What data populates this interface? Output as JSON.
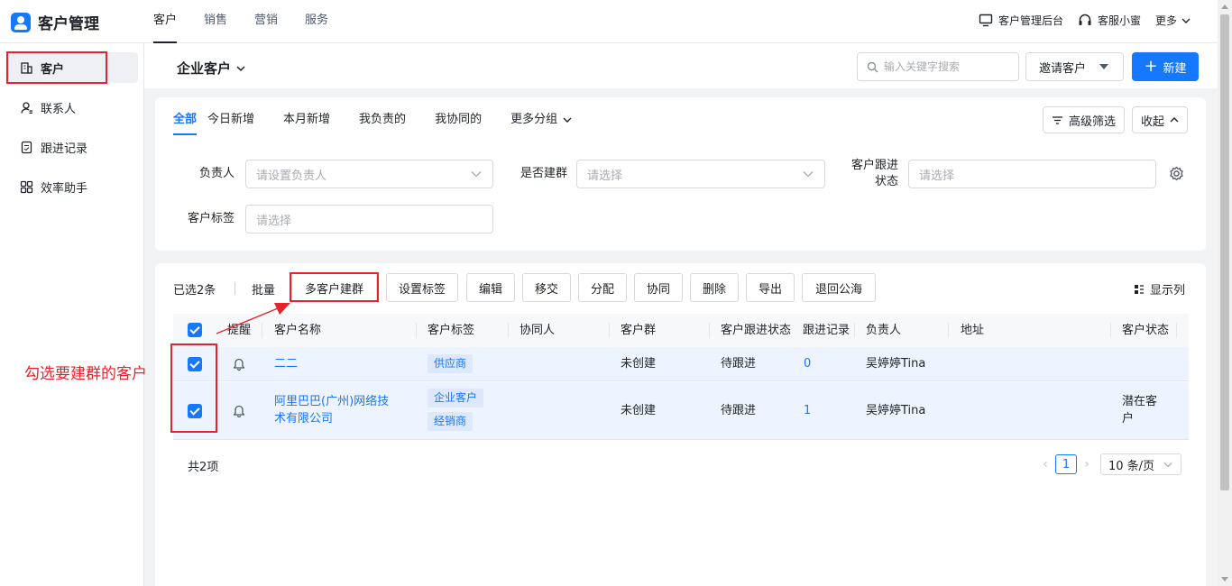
{
  "app": {
    "title": "客户管理"
  },
  "topnav": [
    "客户",
    "销售",
    "营销",
    "服务"
  ],
  "topright": {
    "admin": "客户管理后台",
    "assistant": "客服小蜜",
    "more": "更多"
  },
  "sidebar": [
    {
      "label": "客户",
      "icon": "building-icon",
      "active": true
    },
    {
      "label": "联系人",
      "icon": "contact-icon"
    },
    {
      "label": "跟进记录",
      "icon": "record-icon"
    },
    {
      "label": "效率助手",
      "icon": "grid-icon"
    }
  ],
  "header": {
    "page_title": "企业客户",
    "search_placeholder": "输入关键字搜索",
    "invite_label": "邀请客户",
    "new_label": "新建"
  },
  "tabs": [
    "全部",
    "今日新增",
    "本月新增",
    "我负责的",
    "我协同的",
    "更多分组"
  ],
  "filter_actions": {
    "advanced": "高级筛选",
    "collapse": "收起"
  },
  "filters": {
    "owner_label": "负责人",
    "owner_placeholder": "请设置负责人",
    "group_label": "是否建群",
    "group_placeholder": "请选择",
    "status_label_1": "客户跟进",
    "status_label_2": "状态",
    "status_placeholder": "请选择",
    "tag_label": "客户标签",
    "tag_placeholder": "请选择"
  },
  "toolbar": {
    "selected": "已选2条",
    "batch": "批量",
    "buttons": [
      "多客户建群",
      "设置标签",
      "编辑",
      "移交",
      "分配",
      "协同",
      "删除",
      "导出",
      "退回公海"
    ],
    "columns": "显示列"
  },
  "table": {
    "headers": [
      "提醒",
      "客户名称",
      "客户标签",
      "协同人",
      "客户群",
      "客户跟进状态",
      "跟进记录",
      "负责人",
      "地址",
      "客户状态"
    ],
    "rows": [
      {
        "name_1": "二二",
        "name_2": "",
        "tags": [
          "供应商"
        ],
        "group": "未创建",
        "follow_status": "待跟进",
        "records": "0",
        "owner": "吴婷婷Tina",
        "status_1": "",
        "status_2": ""
      },
      {
        "name_1": "阿里巴巴(广州)网络技",
        "name_2": "术有限公司",
        "tags": [
          "企业客户",
          "经销商"
        ],
        "group": "未创建",
        "follow_status": "待跟进",
        "records": "1",
        "owner": "吴婷婷Tina",
        "status_1": "潜在客",
        "status_2": "户"
      }
    ]
  },
  "footer": {
    "total": "共2项",
    "page": "1",
    "page_size": "10 条/页"
  },
  "annotation": {
    "text": "勾选要建群的客户"
  },
  "colors": {
    "primary": "#1677ff",
    "annotation": "#e5232a",
    "row_selected": "#edf4ff"
  }
}
